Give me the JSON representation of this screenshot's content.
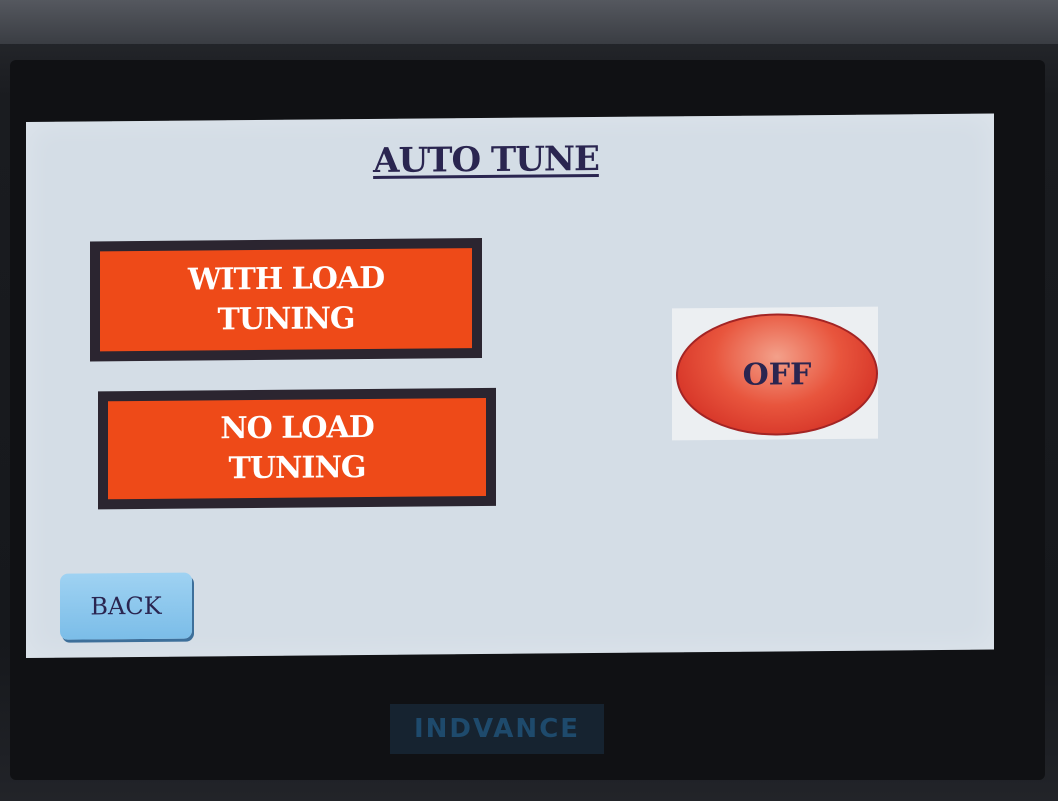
{
  "screen": {
    "title": "AUTO TUNE",
    "with_load_label": "WITH LOAD\nTUNING",
    "no_load_label": "NO LOAD\nTUNING",
    "toggle_label": "OFF",
    "back_label": "BACK"
  },
  "device": {
    "brand": "INDVANCE"
  },
  "colors": {
    "screen_bg": "#d4dde6",
    "tune_button": "#ee4a18",
    "toggle_off": "#e8553d",
    "back_button": "#8cc7ee",
    "title_text": "#2a2550"
  }
}
